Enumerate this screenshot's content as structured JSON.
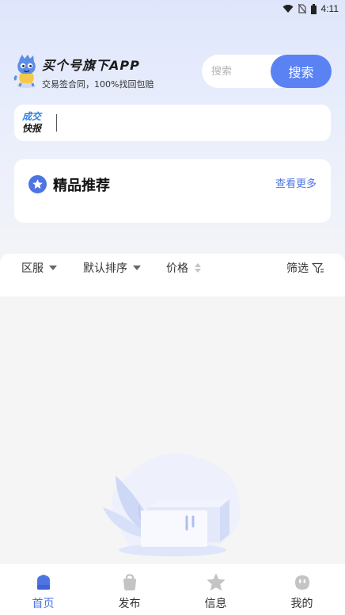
{
  "status_bar": {
    "time": "4:11"
  },
  "brand": {
    "title": "买个号旗下APP",
    "subtitle": "交易签合同，100%找回包赔"
  },
  "search": {
    "placeholder": "搜索",
    "button_label": "搜索"
  },
  "deals": {
    "badge_line1": "成交",
    "badge_line2": "快报"
  },
  "featured": {
    "title": "精品推荐",
    "more_label": "查看更多"
  },
  "filters": {
    "server": "区服",
    "sort": "默认排序",
    "price": "价格",
    "screen": "筛选"
  },
  "tab_bar": {
    "items": [
      {
        "label": "首页",
        "icon": "home-icon",
        "active": true
      },
      {
        "label": "发布",
        "icon": "bag-icon",
        "active": false
      },
      {
        "label": "信息",
        "icon": "star-icon",
        "active": false
      },
      {
        "label": "我的",
        "icon": "face-icon",
        "active": false
      }
    ]
  },
  "colors": {
    "accent": "#5b82f3",
    "link": "#4e74e4",
    "background": "#f5f5f5"
  }
}
